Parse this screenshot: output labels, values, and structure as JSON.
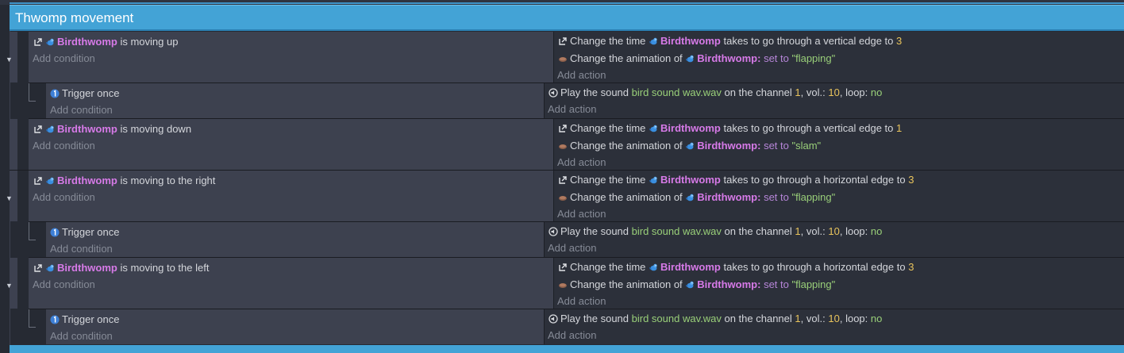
{
  "group": {
    "title": "Thwomp movement"
  },
  "labels": {
    "add_condition": "Add condition",
    "add_action": "Add action",
    "object": "Birdthwomp",
    "object_colon": "Birdthwomp:",
    "change_time": "Change the time",
    "takes_vertical": "takes to go through a vertical edge to",
    "takes_horizontal": "takes to go through a horizontal edge to",
    "change_anim": "Change the animation of",
    "set_to": "set to",
    "trigger_once": "Trigger once",
    "play_sound": "Play the sound",
    "on_channel": "on the channel",
    "vol": "vol.:",
    "loop": "loop:",
    "comma": ","
  },
  "events": [
    {
      "condition": "is moving up",
      "time_value": "3",
      "animation": "\"flapping\"",
      "sub": {
        "sound": "bird sound wav.wav",
        "channel": "1",
        "volume": "10",
        "loop": "no"
      }
    },
    {
      "condition": "is moving down",
      "time_value": "1",
      "animation": "\"slam\""
    },
    {
      "condition": "is moving to the right",
      "time_value": "3",
      "animation": "\"flapping\"",
      "sub": {
        "sound": "bird sound wav.wav",
        "channel": "1",
        "volume": "10",
        "loop": "no"
      }
    },
    {
      "condition": "is moving to the left",
      "time_value": "3",
      "animation": "\"flapping\"",
      "sub": {
        "sound": "bird sound wav.wav",
        "channel": "1",
        "volume": "10",
        "loop": "no"
      }
    }
  ],
  "colors": {
    "group_header": "#43a3d6",
    "object_name": "#d77ae8",
    "number": "#e8c35c",
    "string": "#99cf79",
    "keyword": "#b786d9"
  },
  "icons": {
    "behavior": "bracket-arrow-icon",
    "object": "blue-bird-icon",
    "animation": "film-strip-icon",
    "trigger": "number-one-icon",
    "sound": "speaker-icon"
  }
}
